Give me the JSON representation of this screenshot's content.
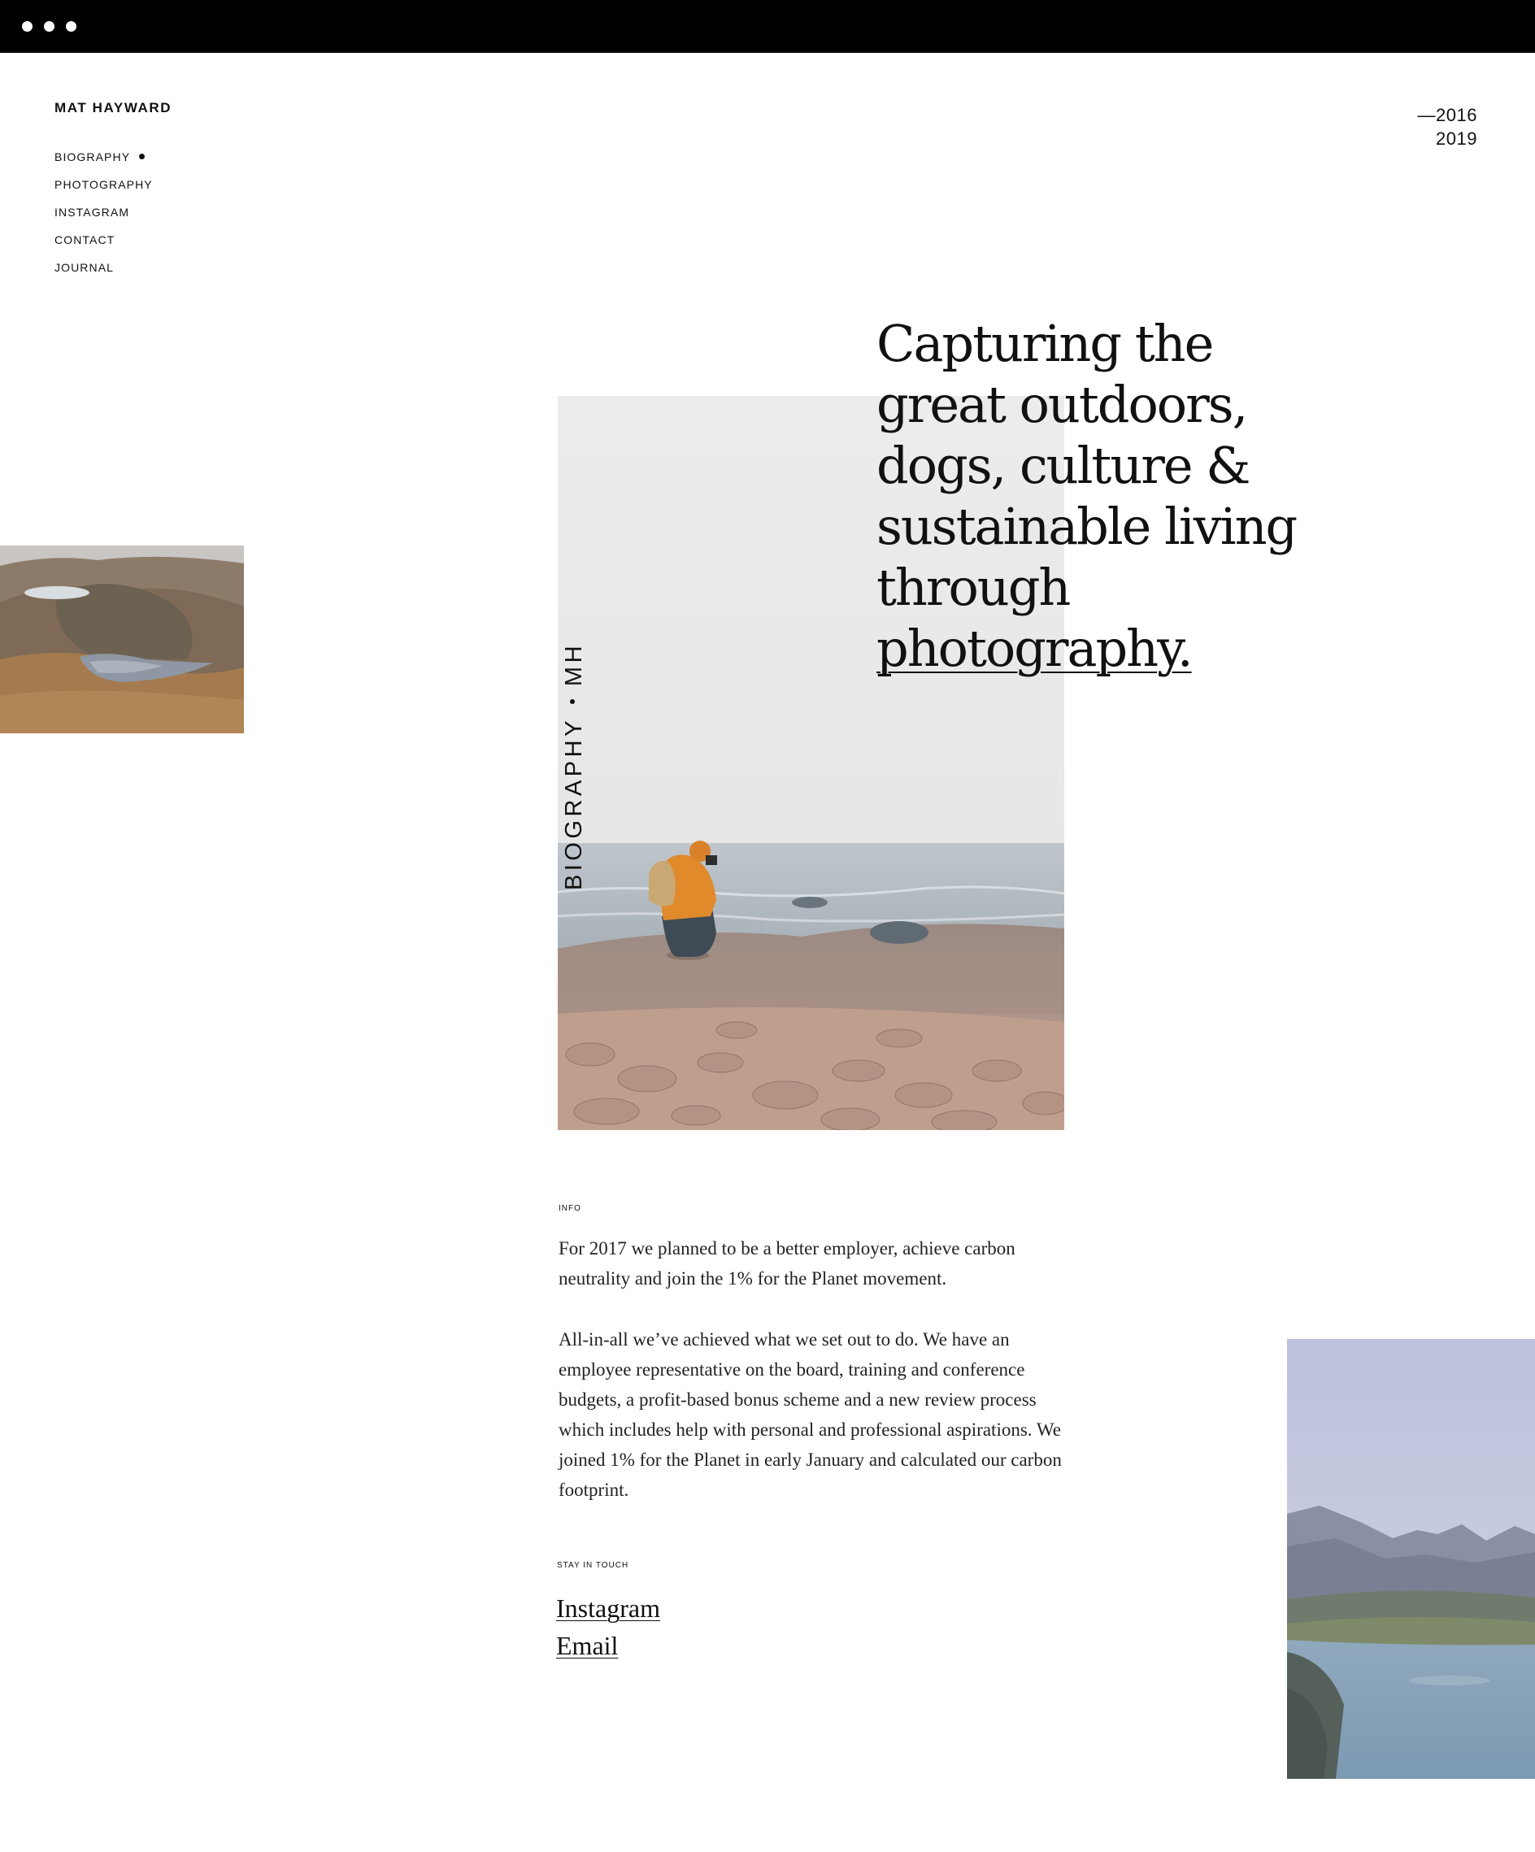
{
  "window": {
    "controls": [
      "close",
      "minimize",
      "zoom"
    ]
  },
  "site": {
    "name": "MAT HAYWARD"
  },
  "nav": {
    "items": [
      {
        "label": "BIOGRAPHY",
        "active": true
      },
      {
        "label": "PHOTOGRAPHY",
        "active": false
      },
      {
        "label": "INSTAGRAM",
        "active": false
      },
      {
        "label": "CONTACT",
        "active": false
      },
      {
        "label": "JOURNAL",
        "active": false
      }
    ]
  },
  "years": {
    "start": "—2016",
    "end": "2019"
  },
  "hero": {
    "headline_text": "Capturing the great outdoors, dogs, culture & sustainable living through ",
    "headline_link": "photography.",
    "side_label_left": "BIOGRAPHY",
    "side_label_right": "MH"
  },
  "photos": {
    "left": "mountain lakes landscape",
    "center": "photographer crouching on rocky shore",
    "right": "mountain lake valley"
  },
  "info": {
    "label": "INFO",
    "paragraphs": [
      "For 2017 we planned to be a better employer, achieve carbon neutrality and join the 1% for the Planet movement.",
      "All-in-all we’ve achieved what we set out to do. We have an employee representative on the board, training and conference budgets, a profit-based bonus scheme and a new review process which includes help with personal and professional aspirations. We joined 1% for the Planet in early January and calculated our carbon footprint."
    ]
  },
  "contact": {
    "label": "STAY IN TOUCH",
    "links": [
      "Instagram",
      "Email"
    ]
  }
}
